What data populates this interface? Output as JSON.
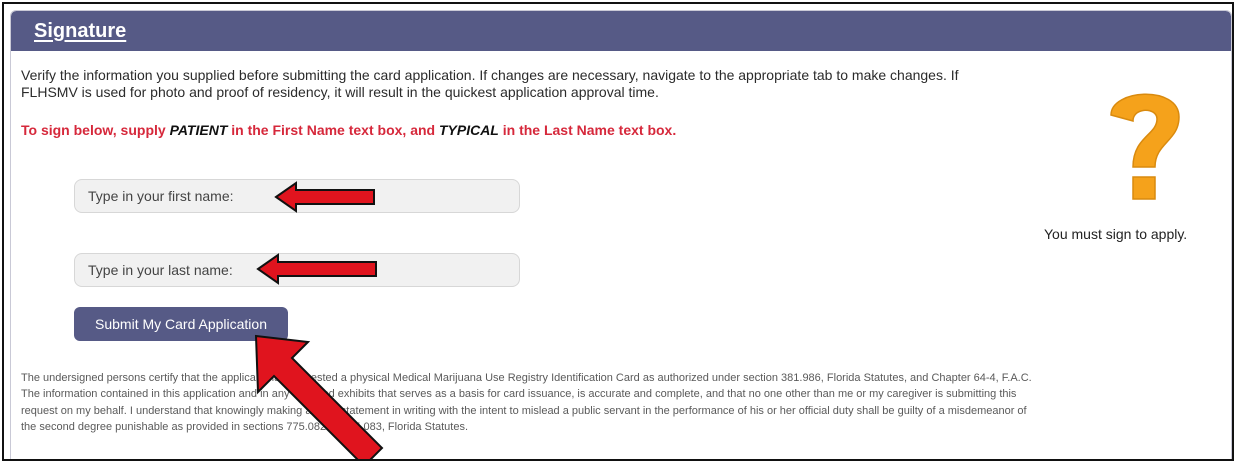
{
  "header": {
    "title": "Signature"
  },
  "intro_text": "Verify the information you supplied before submitting the card application. If changes are necessary, navigate to the appropriate tab to make changes. If FLHSMV is used for photo and proof of residency, it will result in the quickest application approval time.",
  "instruction": {
    "part1": "To sign below, supply ",
    "first_keyword": "PATIENT",
    "part2": " in the First Name text box, and ",
    "last_keyword": "TYPICAL",
    "part3": " in the Last Name text box."
  },
  "form": {
    "first_name_placeholder": "Type in your first name:",
    "last_name_placeholder": "Type in your last name:",
    "submit_label": "Submit My Card Application"
  },
  "help": {
    "icon": "question-mark-icon",
    "text": "You must sign to apply.",
    "color": "#f5a21b"
  },
  "legal_text": "The undersigned persons certify that the applicant has requested a physical Medical Marijuana Use Registry Identification Card as authorized under section 381.986, Florida Statutes, and Chapter 64-4, F.A.C. The information contained in this application and in any attached exhibits that serves as a basis for card issuance, is accurate and complete, and that no one other than me or my caregiver is submitting this request on my behalf. I understand that knowingly making a false statement in writing with the intent to mislead a public servant in the performance of his or her official duty shall be guilty of a misdemeanor of the second degree punishable as provided in sections 775.082 or 775.083, Florida Statutes.",
  "colors": {
    "header_bg": "#565a86",
    "instruction": "#d6283b",
    "annotation_arrow": "#e0141e"
  }
}
